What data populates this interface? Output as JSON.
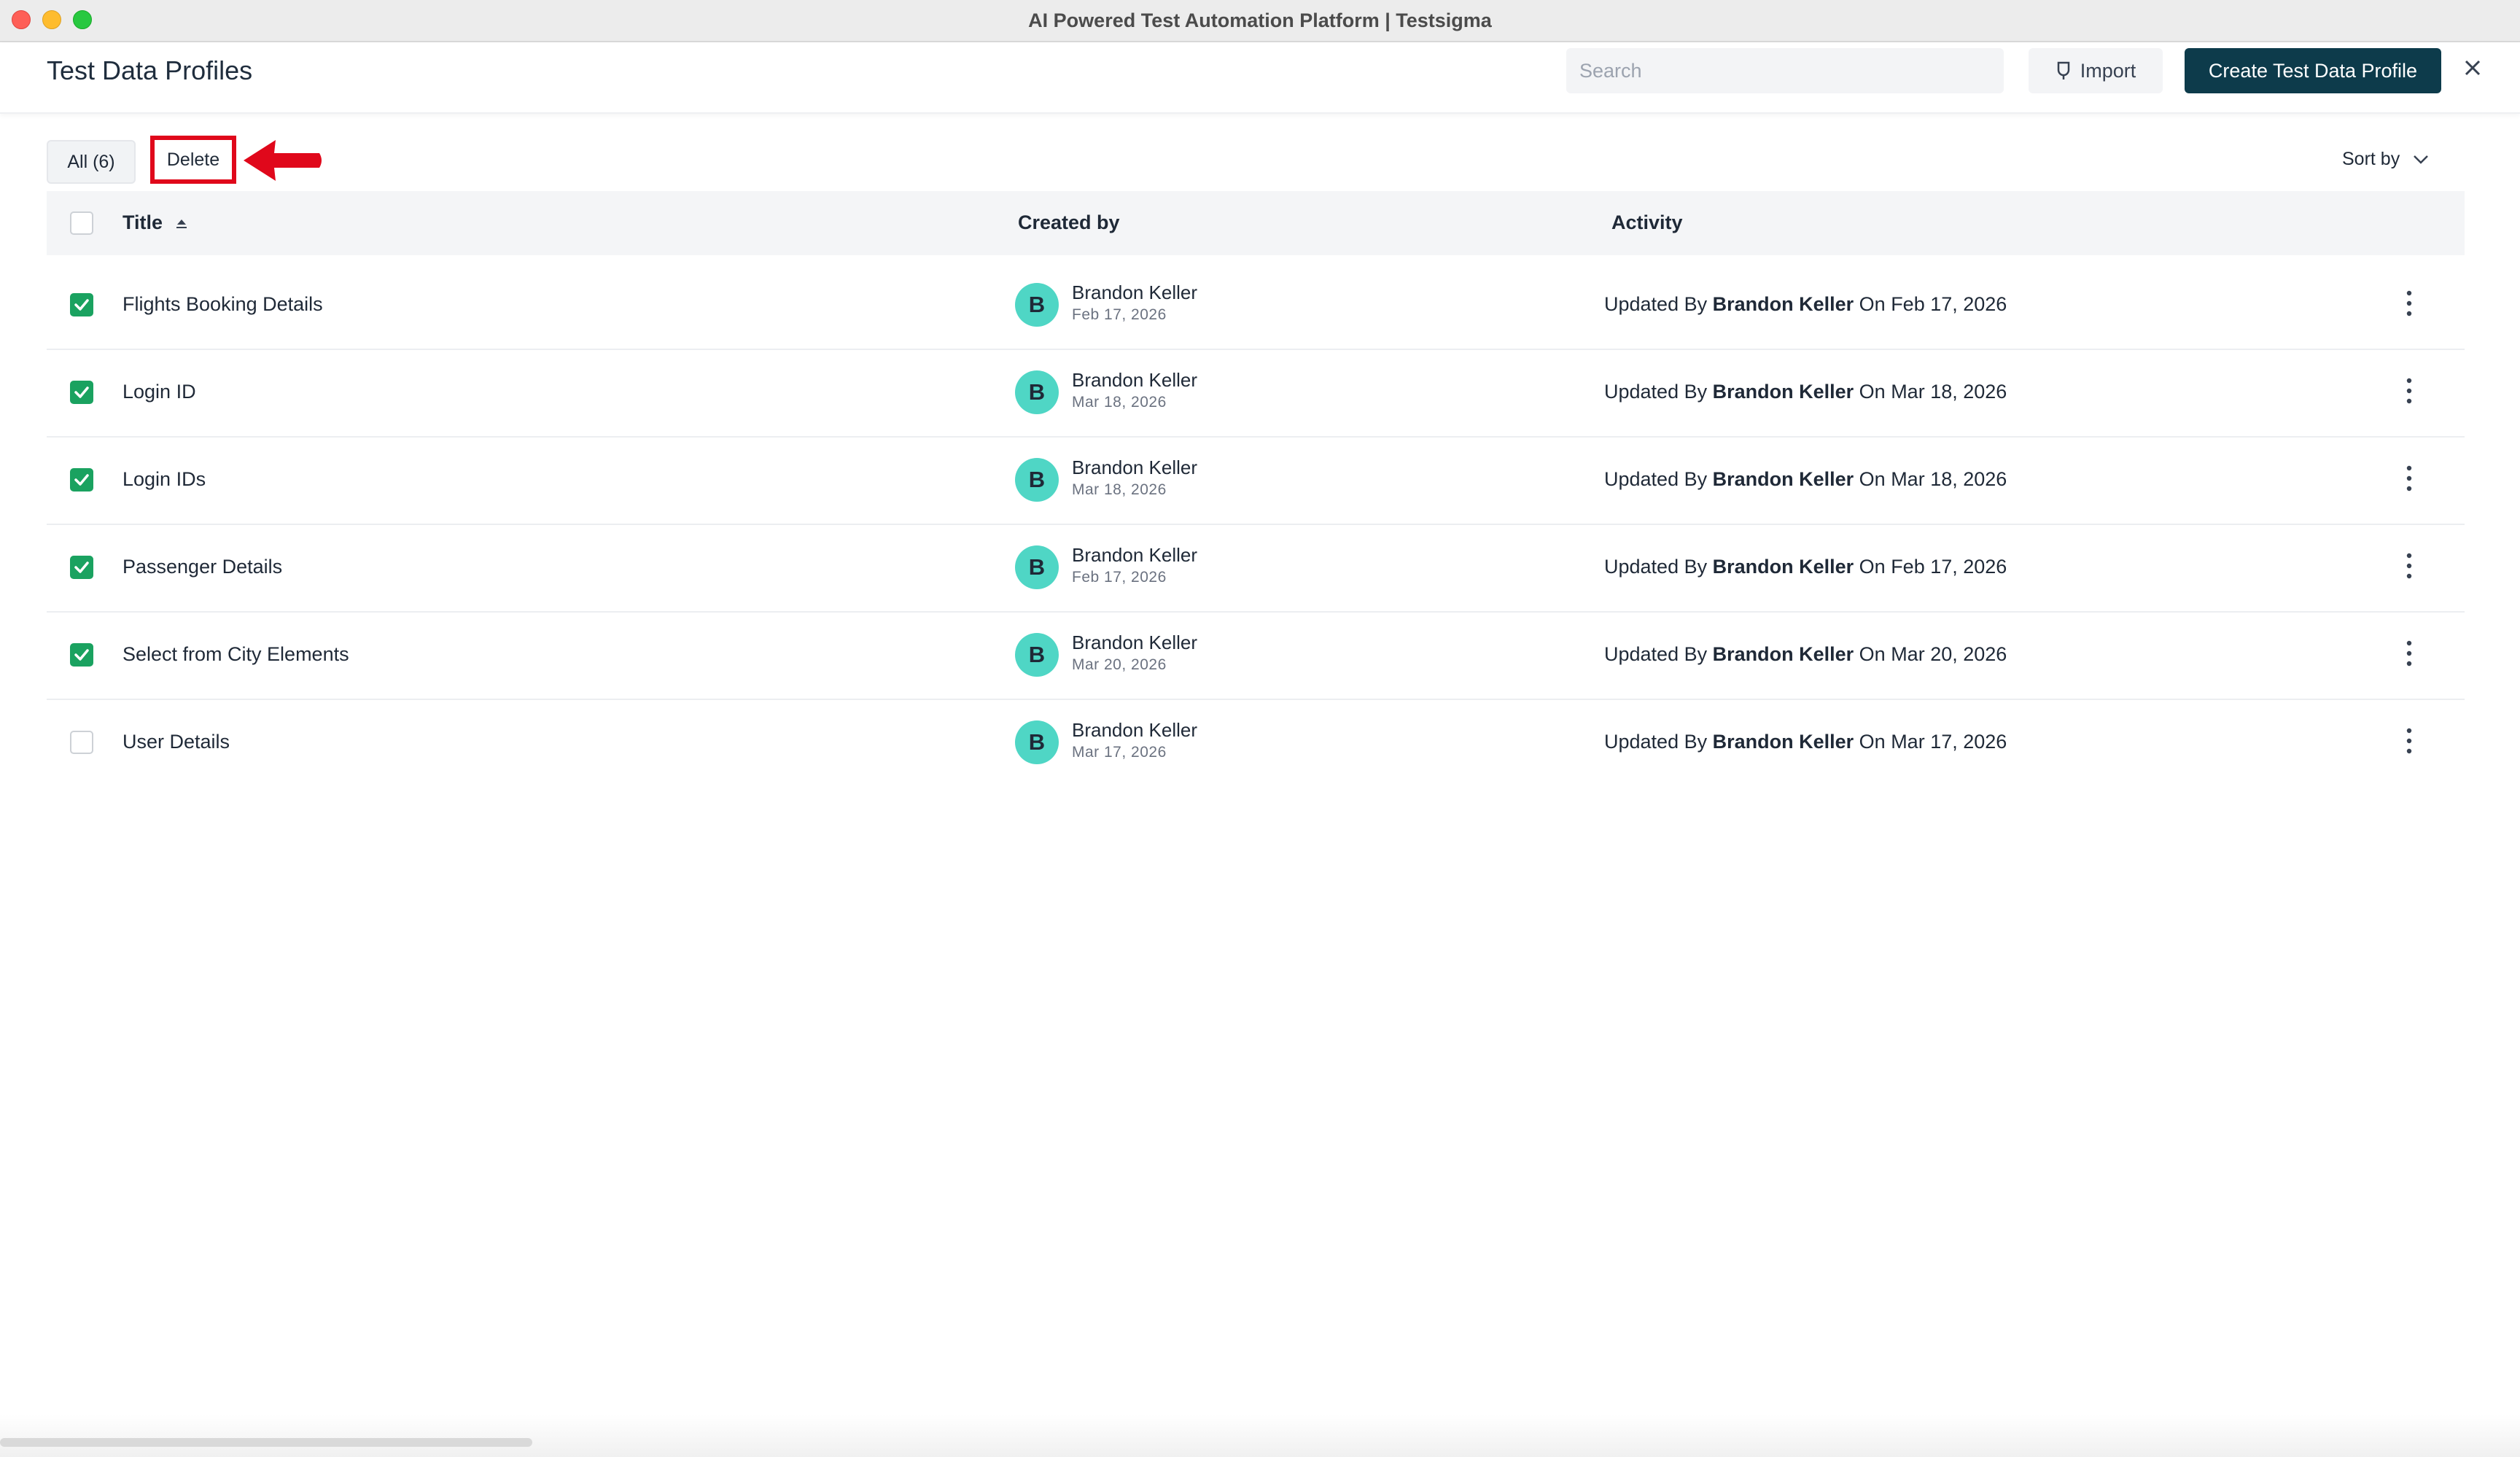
{
  "window": {
    "title": "AI Powered Test Automation Platform | Testsigma"
  },
  "header": {
    "page_title": "Test Data Profiles",
    "search_placeholder": "Search",
    "import_label": "Import",
    "create_label": "Create Test Data Profile"
  },
  "toolbar": {
    "all_label": "All (6)",
    "delete_label": "Delete",
    "sort_label": "Sort by"
  },
  "table": {
    "columns": [
      "Title",
      "Created by",
      "Activity"
    ],
    "rows": [
      {
        "title": "Flights Booking Details",
        "checked": true,
        "avatar": "B",
        "creator": "Brandon Keller",
        "created": "Feb 17, 2026",
        "activity_prefix": "Updated By",
        "activity_user": "Brandon Keller",
        "activity_suffix": "On Feb 17, 2026"
      },
      {
        "title": "Login ID",
        "checked": true,
        "avatar": "B",
        "creator": "Brandon Keller",
        "created": "Mar 18, 2026",
        "activity_prefix": "Updated By",
        "activity_user": "Brandon Keller",
        "activity_suffix": "On Mar 18, 2026"
      },
      {
        "title": "Login IDs",
        "checked": true,
        "avatar": "B",
        "creator": "Brandon Keller",
        "created": "Mar 18, 2026",
        "activity_prefix": "Updated By",
        "activity_user": "Brandon Keller",
        "activity_suffix": "On Mar 18, 2026"
      },
      {
        "title": "Passenger Details",
        "checked": true,
        "avatar": "B",
        "creator": "Brandon Keller",
        "created": "Feb 17, 2026",
        "activity_prefix": "Updated By",
        "activity_user": "Brandon Keller",
        "activity_suffix": "On Feb 17, 2026"
      },
      {
        "title": "Select from City Elements",
        "checked": true,
        "avatar": "B",
        "creator": "Brandon Keller",
        "created": "Mar 20, 2026",
        "activity_prefix": "Updated By",
        "activity_user": "Brandon Keller",
        "activity_suffix": "On Mar 20, 2026"
      },
      {
        "title": "User Details",
        "checked": false,
        "avatar": "B",
        "creator": "Brandon Keller",
        "created": "Mar 17, 2026",
        "activity_prefix": "Updated By",
        "activity_user": "Brandon Keller",
        "activity_suffix": "On Mar 17, 2026"
      }
    ]
  },
  "colors": {
    "primary": "#0d3b4b",
    "check_green": "#1aa260",
    "avatar_teal": "#4fd6c5",
    "highlight_red": "#e0081b"
  },
  "icons": [
    "import-icon",
    "close-icon",
    "sort-asc-icon",
    "chevron-down-icon",
    "kebab-menu-icon",
    "arrow-annotation"
  ]
}
